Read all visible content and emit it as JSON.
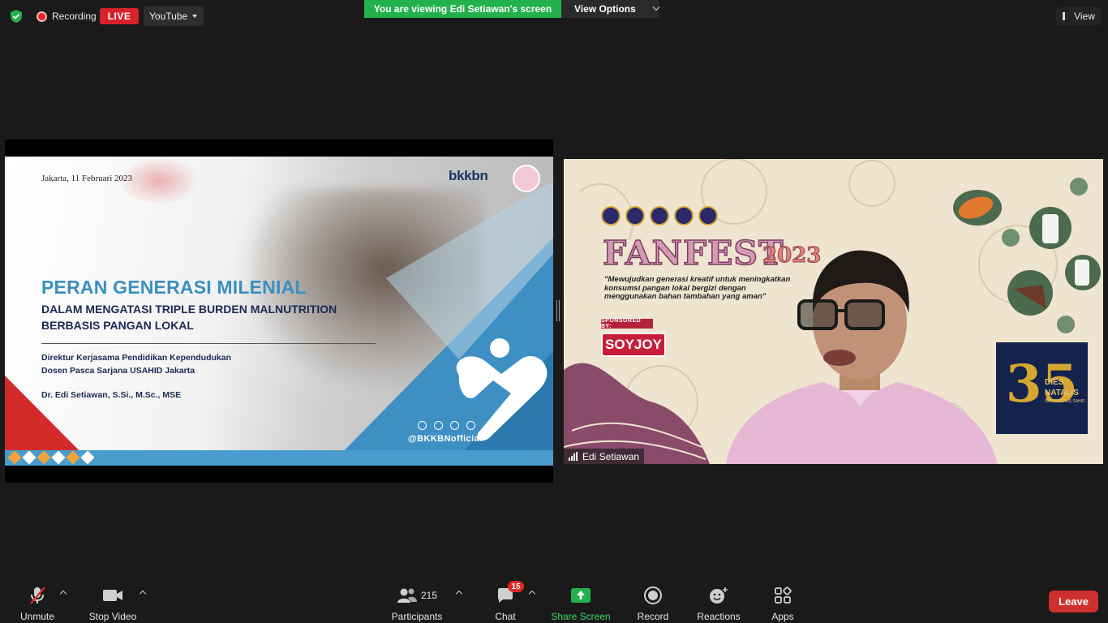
{
  "topbar": {
    "recording_label": "Recording",
    "live_label": "LIVE",
    "stream_target": "YouTube",
    "viewing_banner": "You are viewing Edi Setiawan's screen",
    "view_options_label": "View Options",
    "view_label": "View"
  },
  "slide": {
    "date": "Jakarta, 11 Februari 2023",
    "brand": "bkkbn",
    "title": "PERAN GENERASI MILENIAL",
    "subtitle_line1": "DALAM MENGATASI TRIPLE BURDEN MALNUTRITION",
    "subtitle_line2": "BERBASIS PANGAN LOKAL",
    "role_line1": "Direktur Kerjasama Pendidikan Kependudukan",
    "role_line2": "Dosen Pasca Sarjana USAHID Jakarta",
    "presenter": "Dr. Edi Setiawan, S.Si., M.Sc., MSE",
    "handle": "@BKKBNofficial"
  },
  "video": {
    "event_name": "FANFEST",
    "event_year": "2023",
    "quote": "\"Mewujudkan generasi kreatif untuk meningkatkan konsumsi pangan lokal bergizi dengan menggunakan bahan tambahan yang aman\"",
    "sponsored_label": "SPONSORED BY:",
    "sponsor": "SOYJOY",
    "dies_number": "35",
    "dies_line1": "DIES",
    "dies_line2": "NATALIS",
    "dies_line3": "UNIVERSITAS SAHID",
    "participant_name": "Edi Setiawan"
  },
  "toolbar": {
    "unmute": "Unmute",
    "stop_video": "Stop Video",
    "participants": "Participants",
    "participants_count": "215",
    "chat": "Chat",
    "chat_badge": "15",
    "share_screen": "Share Screen",
    "record": "Record",
    "reactions": "Reactions",
    "apps": "Apps",
    "leave": "Leave"
  },
  "colors": {
    "share_green": "#23b14d",
    "live_red": "#d8222a",
    "leave_red": "#d02f2f",
    "slide_blue": "#3a8fc0"
  }
}
